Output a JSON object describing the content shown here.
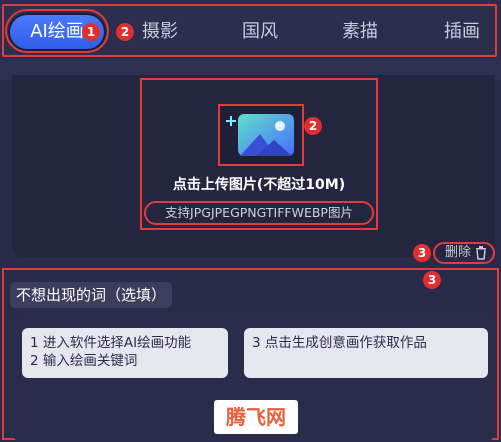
{
  "tabs": [
    {
      "label": "AI绘画",
      "active": true
    },
    {
      "label": "摄影",
      "active": false
    },
    {
      "label": "国风",
      "active": false
    },
    {
      "label": "素描",
      "active": false
    },
    {
      "label": "插画",
      "active": false
    }
  ],
  "upload": {
    "label": "点击上传图片(不超过10M)",
    "formats": "支持JPGJPEGPNGTIFFWEBP图片",
    "icon": "image-upload-icon"
  },
  "delete": {
    "label": "删除",
    "icon": "trash-icon"
  },
  "negative_prompt": {
    "title": "不想出现的词（选填）"
  },
  "tips": [
    {
      "line1": "1 进入软件选择AI绘画功能",
      "line2": "2 输入绘画关键词"
    },
    {
      "line1": "3 点击生成创意画作获取作品",
      "line2": ""
    }
  ],
  "watermark": "腾飞网",
  "annotations": [
    "1",
    "2",
    "2",
    "3",
    "3"
  ],
  "colors": {
    "accent": "#3b6cf2",
    "annotation": "#e23b3b",
    "background": "#2a2b48"
  }
}
